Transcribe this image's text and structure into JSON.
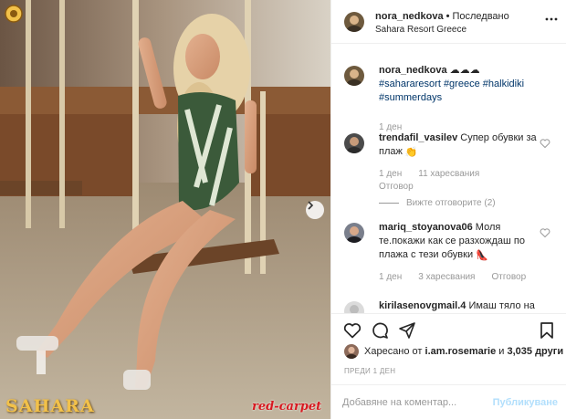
{
  "post": {
    "author": "nora_nedkova",
    "separator": "•",
    "follow_status": "Последвано",
    "location": "Sahara Resort Greece",
    "more_icon": "more-dots-icon"
  },
  "photo": {
    "brand_left": "SAHARA",
    "brand_right": "red-carpet",
    "next_icon": "chevron-right-icon"
  },
  "caption": {
    "user": "nora_nedkova",
    "emoji": "☁☁☁",
    "hashtags": [
      "#sahararesort",
      "#greece",
      "#halkidiki",
      "#summerdays"
    ],
    "age": "1 ден"
  },
  "comments": [
    {
      "user": "trendafil_vasilev",
      "text": "Супер обувки за плаж",
      "emoji": "👏",
      "age": "1 ден",
      "likes": "11 харесвания",
      "reply": "Отговор",
      "view_replies": "Вижте отговорите (2)"
    },
    {
      "user": "mariq_stoyanova06",
      "text": "Моля те.покажи как се разхождаш по плажа с тези обувки",
      "emoji": "👠",
      "age": "1 ден",
      "likes": "3 харесвания",
      "reply": "Отговор"
    },
    {
      "user": "kirilasenovgmail.4",
      "text": "Имаш тяло на",
      "age": "",
      "likes": "",
      "reply": ""
    }
  ],
  "actions": {
    "like_icon": "heart-icon",
    "comment_icon": "comment-icon",
    "share_icon": "share-icon",
    "save_icon": "bookmark-icon"
  },
  "likes": {
    "prefix": "Харесано от",
    "user": "i.am.rosemarie",
    "connector": "и",
    "others": "3,035 други"
  },
  "date": "ПРЕДИ 1 ДЕН",
  "add_comment": {
    "placeholder": "Добавяне на коментар...",
    "post_label": "Публикуване"
  },
  "colors": {
    "link": "#003569",
    "muted": "#999999",
    "post_disabled": "#b2dffc",
    "brand_gold": "#f2c14a",
    "brand_red": "#d71920"
  }
}
